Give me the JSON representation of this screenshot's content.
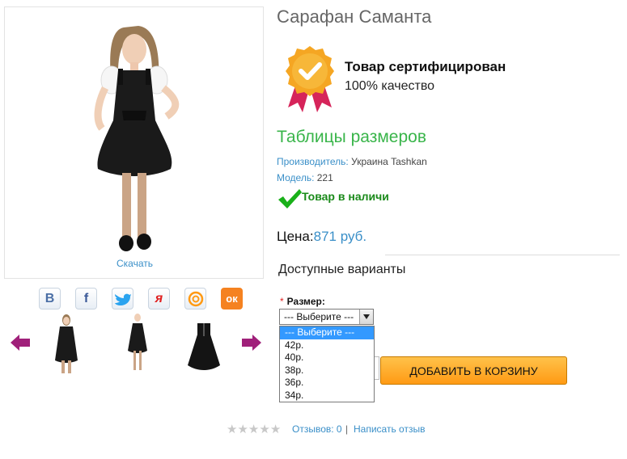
{
  "product": {
    "title": "Сарафан Саманта",
    "download_label": "Скачать"
  },
  "certificate": {
    "title": "Товар сертифицирован",
    "subtitle": "100% качество",
    "badge_color": "#f5a623",
    "ribbon_color": "#d6245a"
  },
  "size_table_link": "Таблицы размеров",
  "manufacturer": {
    "label": "Производитель:",
    "value": "Украина Tashkan"
  },
  "model": {
    "label": "Модель:",
    "value": "221"
  },
  "stock": {
    "text": "Товар в наличи",
    "icon": "check-icon",
    "color": "#1a8a1a"
  },
  "price": {
    "label": "Цена:",
    "value": "871 руб."
  },
  "options": {
    "title": "Доступные варианты",
    "size_label": "Размер:",
    "required_mark": "*",
    "selected": "--- Выберите ---",
    "items": [
      "--- Выберите ---",
      "42р.",
      "40р.",
      "38р.",
      "36р.",
      "34р."
    ]
  },
  "add_to_cart_label": "ДОБАВИТЬ В КОРЗИНУ",
  "social": [
    {
      "name": "vkontakte-icon",
      "glyph": "В",
      "color": "#4a6ea5"
    },
    {
      "name": "facebook-icon",
      "glyph": "f",
      "color": "#3b5998"
    },
    {
      "name": "twitter-icon",
      "glyph": "🐦",
      "color": "#2aa3ef"
    },
    {
      "name": "yaru-icon",
      "glyph": "я",
      "color": "#e02020"
    },
    {
      "name": "mailru-icon",
      "glyph": "@",
      "color": "#ff9a14"
    },
    {
      "name": "odnoklassniki-icon",
      "glyph": "ок",
      "color": "#ffffff"
    }
  ],
  "reviews": {
    "rating": 0,
    "max": 5,
    "count_text": "Отзывов: 0",
    "separator": "|",
    "write_text": "Написать отзыв"
  },
  "colors": {
    "link": "#3a8fc8",
    "green": "#39b54a",
    "arrow": "#a0207a"
  }
}
